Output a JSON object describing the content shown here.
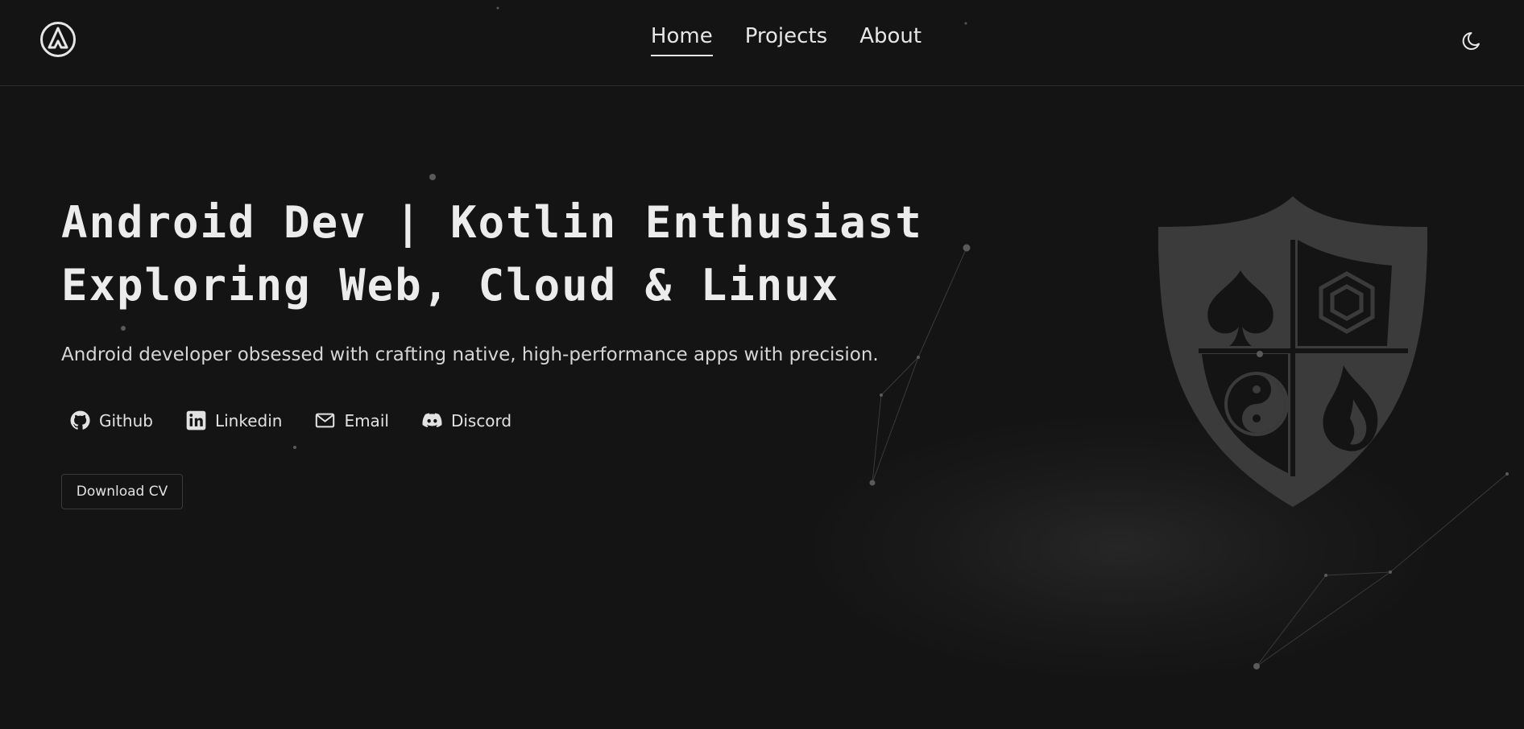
{
  "header": {
    "logo_icon": "delta-circle-logo-icon",
    "nav": [
      {
        "label": "Home",
        "active": true
      },
      {
        "label": "Projects",
        "active": false
      },
      {
        "label": "About",
        "active": false
      }
    ],
    "theme_toggle_icon": "moon-icon"
  },
  "hero": {
    "headline_line1": "Android Dev | Kotlin Enthusiast",
    "headline_line2": "Exploring Web, Cloud & Linux",
    "subtitle": "Android developer obsessed with crafting native, high-performance apps with precision.",
    "socials": [
      {
        "label": "Github",
        "icon": "github-icon"
      },
      {
        "label": "Linkedin",
        "icon": "linkedin-icon"
      },
      {
        "label": "Email",
        "icon": "mail-icon"
      },
      {
        "label": "Discord",
        "icon": "discord-icon"
      }
    ],
    "cv_button": "Download CV"
  },
  "illustration": {
    "name": "shield-emblem",
    "symbols": [
      "spade-icon",
      "hexagon-icon",
      "yin-yang-icon",
      "flame-icon"
    ]
  },
  "colors": {
    "background": "#141414",
    "text": "#ececec",
    "shield": "#3a3a3a"
  }
}
